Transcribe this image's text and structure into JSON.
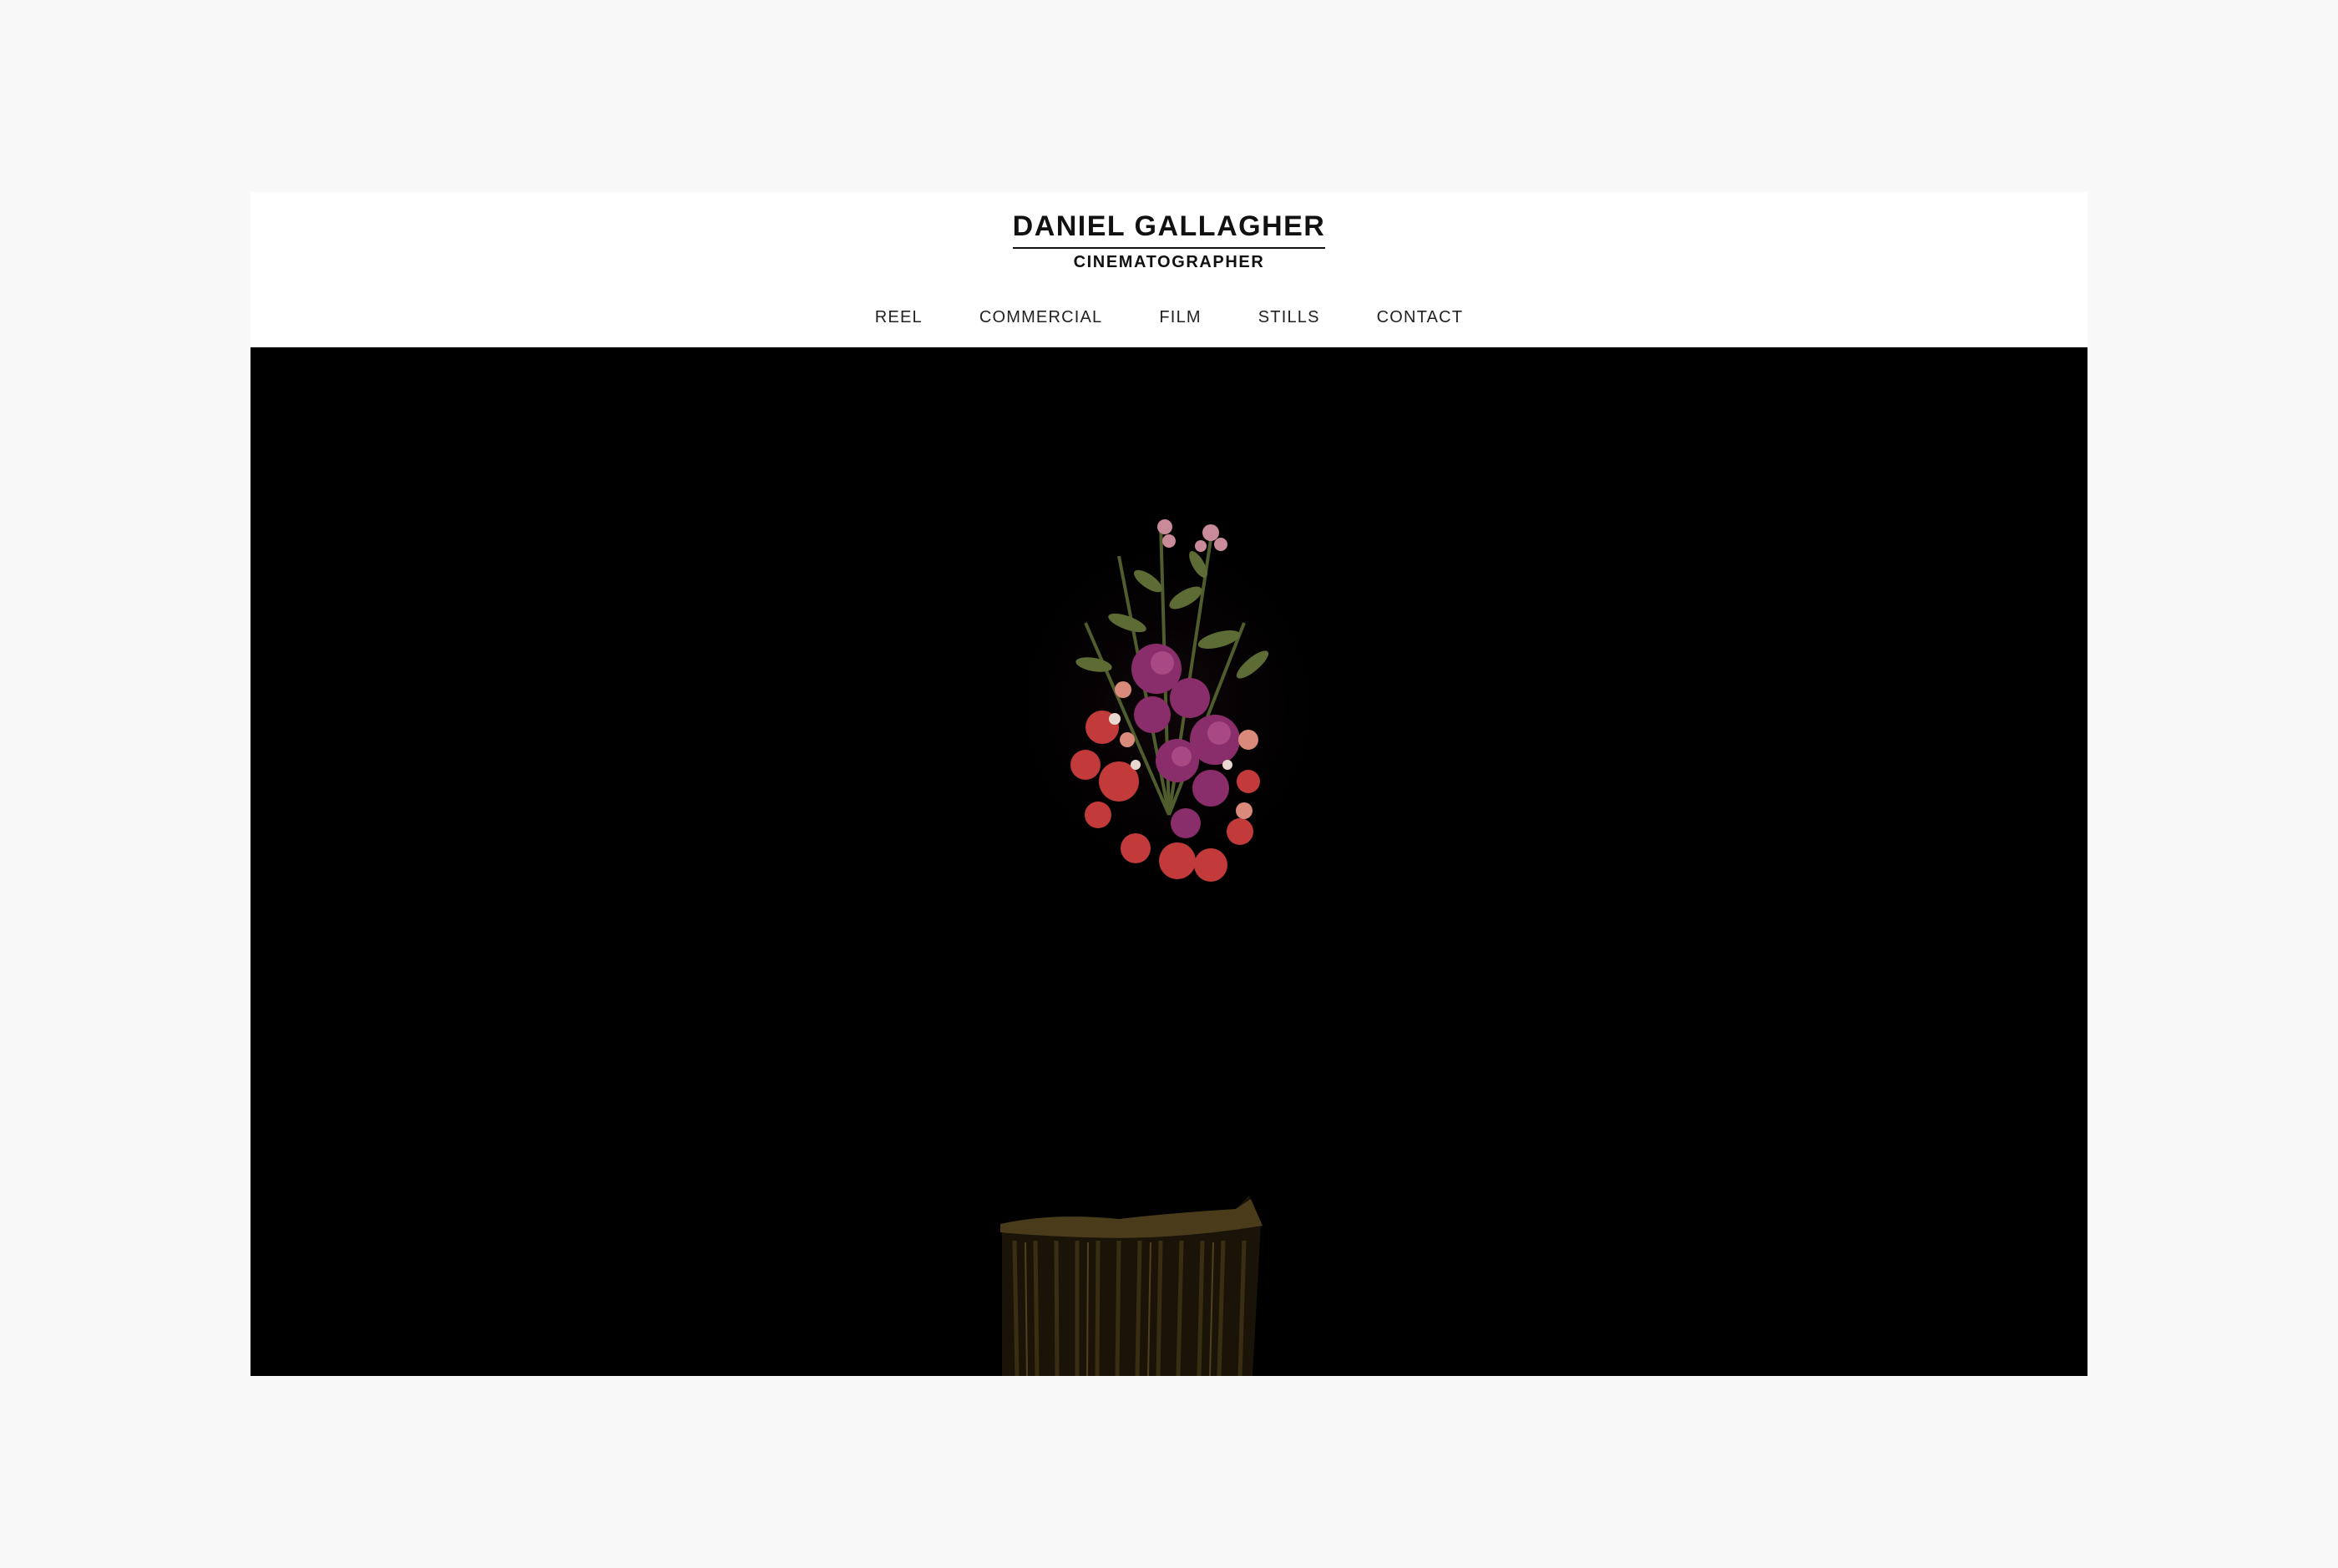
{
  "header": {
    "name": "DANIEL GALLAGHER",
    "tagline": "CINEMATOGRAPHER"
  },
  "nav": {
    "items": [
      {
        "label": "REEL"
      },
      {
        "label": "COMMERCIAL"
      },
      {
        "label": "FILM"
      },
      {
        "label": "STILLS"
      },
      {
        "label": "CONTACT"
      }
    ]
  },
  "hero": {
    "background": "#000000",
    "accent_colors": [
      "#8a2e6b",
      "#c23a3a",
      "#5d6b35",
      "#6b5228"
    ]
  }
}
